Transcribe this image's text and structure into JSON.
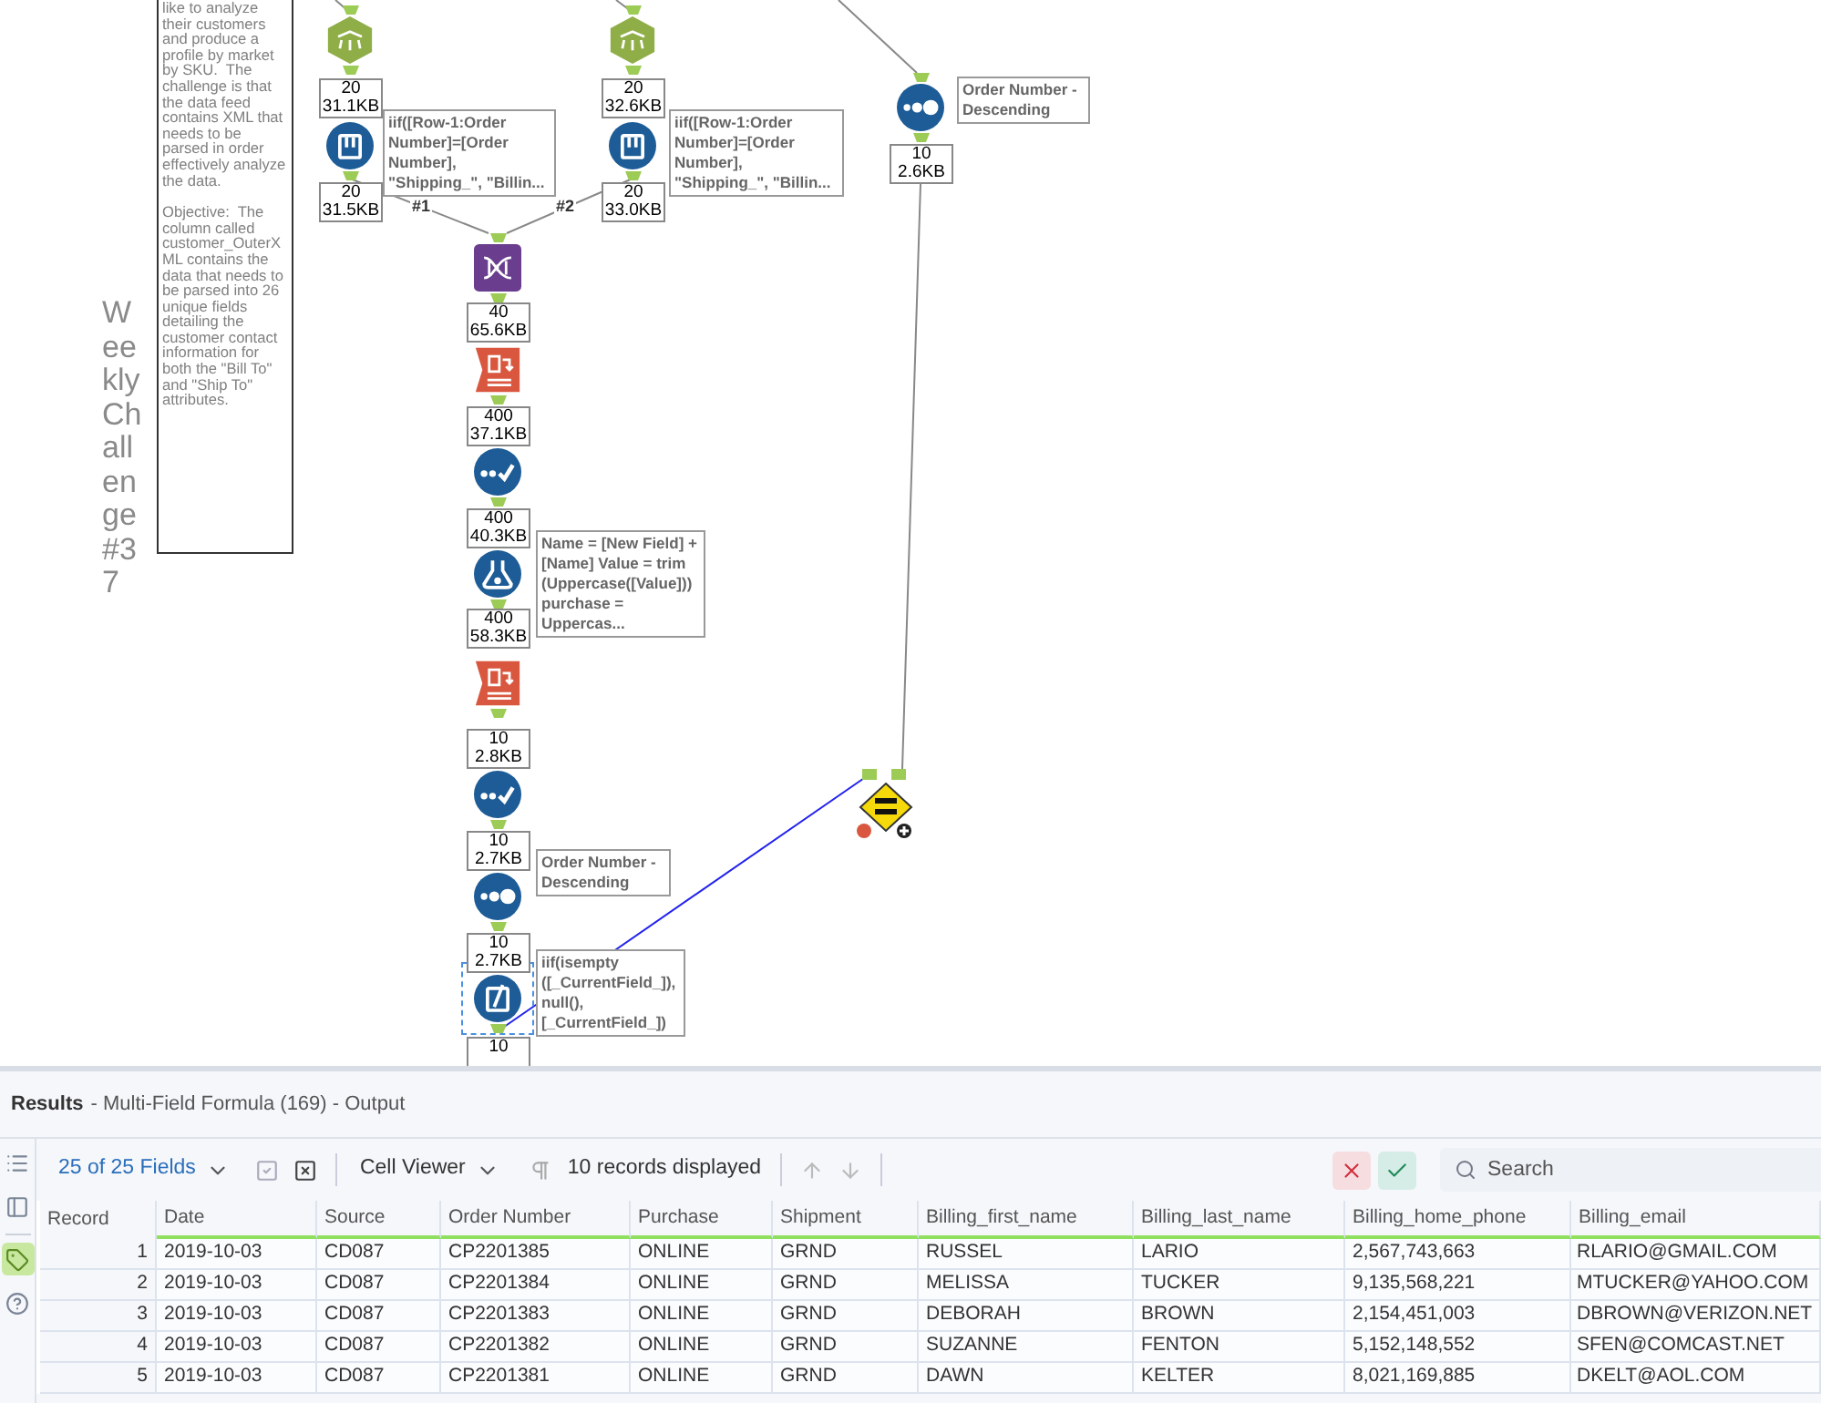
{
  "canvas": {
    "comment": {
      "paragraphs": [
        "like to analyze their customers and produce a profile by market by SKU.  The challenge is that the data feed contains XML that needs to be parsed in order effectively analyze the data.",
        "Objective:  The column called customer_OuterXML contains the data that needs to be parsed into 26 unique fields detailing the customer contact information for both the \"Bill To\" and \"Ship To\" attributes."
      ]
    },
    "title": "Weekly Challenge #37",
    "nodes": [
      {
        "kind": "xml_parse",
        "selected": false
      },
      {
        "kind": "xml_parse",
        "selected": false
      },
      {
        "kind": "multi_row",
        "selected": false
      },
      {
        "kind": "multi_row",
        "selected": false
      },
      {
        "kind": "union",
        "selected": false
      },
      {
        "kind": "transpose",
        "selected": false
      },
      {
        "kind": "select",
        "selected": false
      },
      {
        "kind": "formula",
        "selected": false
      },
      {
        "kind": "crosstab",
        "selected": false
      },
      {
        "kind": "select",
        "selected": false
      },
      {
        "kind": "sort",
        "selected": false
      },
      {
        "kind": "multi_field",
        "selected": true
      },
      {
        "kind": "sort",
        "selected": false
      },
      {
        "kind": "compare",
        "selected": false
      }
    ],
    "record_counts": [
      {
        "records": "20",
        "size": "31.1KB"
      },
      {
        "records": "20",
        "size": "32.6KB"
      },
      {
        "records": "20",
        "size": "31.5KB"
      },
      {
        "records": "20",
        "size": "33.0KB"
      },
      {
        "records": "40",
        "size": "65.6KB"
      },
      {
        "records": "400",
        "size": "37.1KB"
      },
      {
        "records": "400",
        "size": "40.3KB"
      },
      {
        "records": "400",
        "size": "58.3KB"
      },
      {
        "records": "10",
        "size": "2.8KB"
      },
      {
        "records": "10",
        "size": "2.7KB"
      },
      {
        "records": "10",
        "size": "2.7KB"
      },
      {
        "records": "10"
      },
      {
        "records": "10",
        "size": "2.6KB"
      }
    ],
    "annotations": [
      "iif([Row-1:Order Number]=[Order Number], \"Shipping_\", \"Billin...",
      "iif([Row-1:Order Number]=[Order Number], \"Shipping_\", \"Billin...",
      "Name = [New Field] + [Name] Value = trim (Uppercase([Value])) purchase = Uppercas...",
      "Order Number - Descending",
      "iif(isempty ([_CurrentField_]), null(), [_CurrentField_])",
      "Order Number - Descending"
    ],
    "connection_labels": [
      "#1",
      "#2"
    ]
  },
  "results": {
    "title": "Results",
    "subtitle": "- Multi-Field Formula (169) - Output",
    "sidebar": [
      {
        "kind": "list",
        "selected": false
      },
      {
        "kind": "panel",
        "selected": false
      },
      {
        "kind": "tag",
        "selected": true
      },
      {
        "kind": "help",
        "selected": false
      }
    ],
    "toolbar": {
      "fields": "25 of 25 Fields",
      "viewer": "Cell Viewer",
      "records": "10 records displayed"
    },
    "search": {
      "placeholder": "Search"
    },
    "table": {
      "columns": [
        "Record",
        "Date",
        "Source",
        "Order Number",
        "Purchase",
        "Shipment",
        "Billing_first_name",
        "Billing_last_name",
        "Billing_home_phone",
        "Billing_email"
      ],
      "rows": [
        [
          "1",
          "2019-10-03",
          "CD087",
          "CP2201385",
          "ONLINE",
          "GRND",
          "RUSSEL",
          "LARIO",
          "2,567,743,663",
          "RLARIO@GMAIL.COM"
        ],
        [
          "2",
          "2019-10-03",
          "CD087",
          "CP2201384",
          "ONLINE",
          "GRND",
          "MELISSA",
          "TUCKER",
          "9,135,568,221",
          "MTUCKER@YAHOO.COM"
        ],
        [
          "3",
          "2019-10-03",
          "CD087",
          "CP2201383",
          "ONLINE",
          "GRND",
          "DEBORAH",
          "BROWN",
          "2,154,451,003",
          "DBROWN@VERIZON.NET"
        ],
        [
          "4",
          "2019-10-03",
          "CD087",
          "CP2201382",
          "ONLINE",
          "GRND",
          "SUZANNE",
          "FENTON",
          "5,152,148,552",
          "SFEN@COMCAST.NET"
        ],
        [
          "5",
          "2019-10-03",
          "CD087",
          "CP2201381",
          "ONLINE",
          "GRND",
          "DAWN",
          "KELTER",
          "8,021,169,885",
          "DKELT@AOL.COM"
        ]
      ]
    }
  }
}
